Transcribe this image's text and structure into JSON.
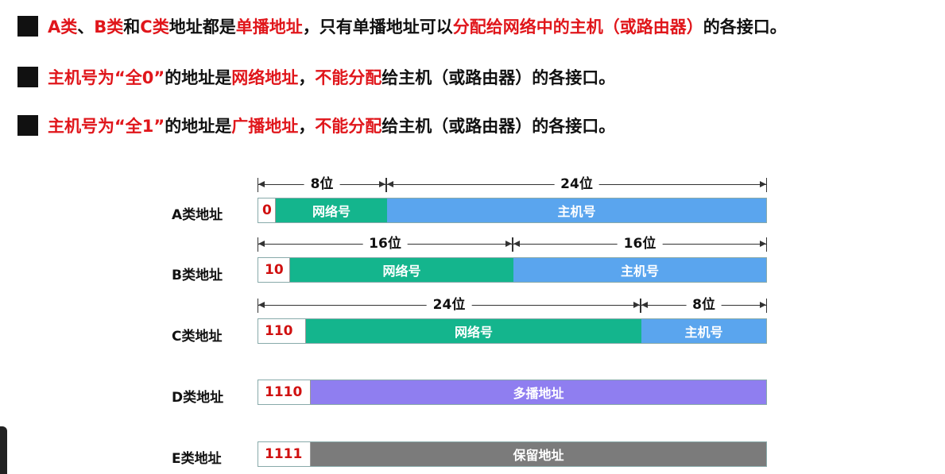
{
  "bullets": [
    {
      "parts": [
        {
          "text": "A类",
          "red": true
        },
        {
          "text": "、",
          "red": false
        },
        {
          "text": "B类",
          "red": true
        },
        {
          "text": "和",
          "red": false
        },
        {
          "text": "C类",
          "red": true
        },
        {
          "text": "地址都是",
          "red": false
        },
        {
          "text": "单播地址",
          "red": true
        },
        {
          "text": "，只有单播地址可以",
          "red": false
        },
        {
          "text": "分配给网络中的主机（或路由器）",
          "red": true
        },
        {
          "text": "的各接口。",
          "red": false
        }
      ]
    },
    {
      "parts": [
        {
          "text": "主机号为“全0”",
          "red": true
        },
        {
          "text": "的地址是",
          "red": false
        },
        {
          "text": "网络地址",
          "red": true
        },
        {
          "text": "，",
          "red": false
        },
        {
          "text": "不能分配",
          "red": true
        },
        {
          "text": "给主机（或路由器）的各接口。",
          "red": false
        }
      ]
    },
    {
      "parts": [
        {
          "text": "主机号为“全1”",
          "red": true
        },
        {
          "text": "的地址是",
          "red": false
        },
        {
          "text": "广播地址",
          "red": true
        },
        {
          "text": "，",
          "red": false
        },
        {
          "text": "不能分配",
          "red": true
        },
        {
          "text": "给主机（或路由器）的各接口。",
          "red": false
        }
      ]
    }
  ],
  "rows": [
    {
      "label": "A类地址",
      "prefix": "0",
      "net_label": "网络号",
      "host_label": "主机号",
      "net_bits_label": "8位",
      "host_bits_label": "24位"
    },
    {
      "label": "B类地址",
      "prefix": "10",
      "net_label": "网络号",
      "host_label": "主机号",
      "net_bits_label": "16位",
      "host_bits_label": "16位"
    },
    {
      "label": "C类地址",
      "prefix": "110",
      "net_label": "网络号",
      "host_label": "主机号",
      "net_bits_label": "24位",
      "host_bits_label": "8位"
    },
    {
      "label": "D类地址",
      "prefix": "1110",
      "body_label": "多播地址"
    },
    {
      "label": "E类地址",
      "prefix": "1111",
      "body_label": "保留地址"
    }
  ],
  "colors": {
    "red": "#e0161b",
    "network": "#14b58d",
    "host": "#5aa5ee",
    "multicast": "#8f7ef0",
    "reserved": "#7b7b7b"
  }
}
